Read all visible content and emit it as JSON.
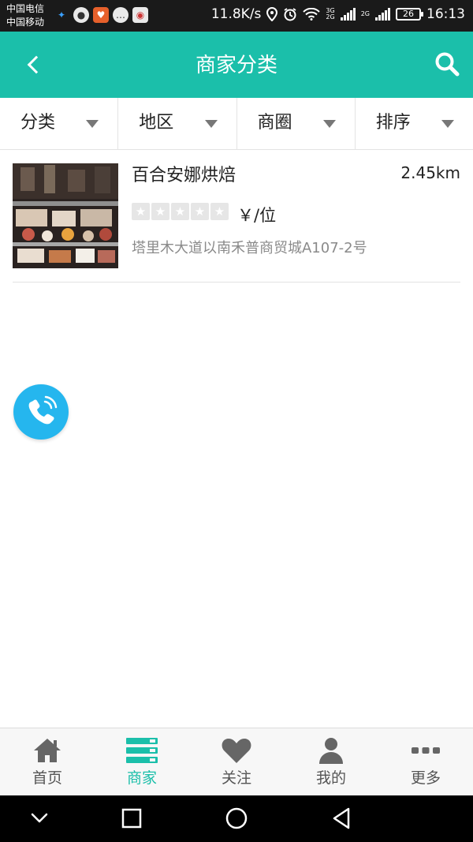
{
  "status_bar": {
    "carrier1": "中国电信",
    "carrier2": "中国移动",
    "speed": "11.8K/s",
    "net1": "3G",
    "net2": "2G",
    "net3": "2G",
    "battery": "26",
    "time": "16:13"
  },
  "header": {
    "title": "商家分类",
    "back_icon": "chevron-left-icon",
    "search_icon": "search-icon",
    "bg_color": "#1bbfaa"
  },
  "filters": [
    {
      "label": "分类"
    },
    {
      "label": "地区"
    },
    {
      "label": "商圈"
    },
    {
      "label": "排序"
    }
  ],
  "listings": [
    {
      "name": "百合安娜烘焙",
      "distance": "2.45km",
      "rating": 0,
      "max_rating": 5,
      "price": "￥/位",
      "address": "塔里木大道以南禾普商贸城A107-2号"
    }
  ],
  "call_button": {
    "icon": "phone-icon",
    "color": "#25b6ee"
  },
  "bottom_nav": [
    {
      "label": "首页",
      "icon": "home-icon",
      "active": false
    },
    {
      "label": "商家",
      "icon": "store-list-icon",
      "active": true
    },
    {
      "label": "关注",
      "icon": "heart-icon",
      "active": false
    },
    {
      "label": "我的",
      "icon": "user-icon",
      "active": false
    },
    {
      "label": "更多",
      "icon": "more-dots-icon",
      "active": false
    }
  ],
  "colors": {
    "accent": "#1bbfaa",
    "inactive": "#555555"
  }
}
